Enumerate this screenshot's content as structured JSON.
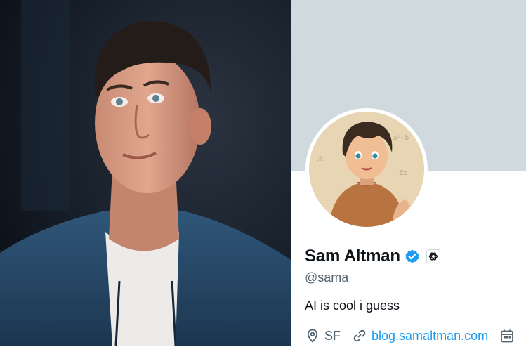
{
  "profile": {
    "display_name": "Sam Altman",
    "handle": "@sama",
    "bio": "AI is cool i guess",
    "location": "SF",
    "website": "blog.samaltman.com",
    "verified": true
  },
  "colors": {
    "banner": "#cfd9de",
    "verified_blue": "#1d9bf0",
    "link": "#1d9bf0",
    "text_primary": "#0f1419",
    "text_secondary": "#536471"
  },
  "icons": {
    "verified": "verified-badge-icon",
    "organization": "openai-logo-icon",
    "location": "location-pin-icon",
    "website": "link-icon",
    "joined": "calendar-icon"
  }
}
